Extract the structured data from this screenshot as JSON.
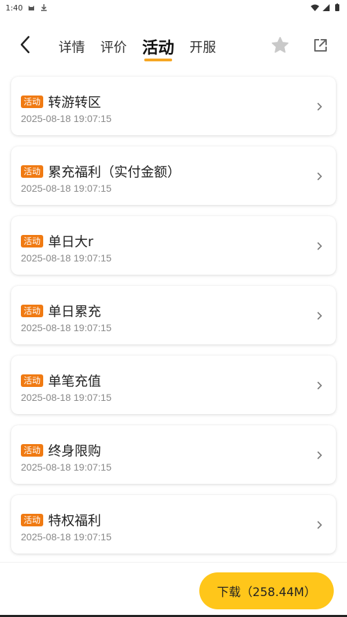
{
  "status_bar": {
    "time": "1:40"
  },
  "header": {
    "tabs": [
      {
        "label": "详情",
        "active": false
      },
      {
        "label": "评价",
        "active": false
      },
      {
        "label": "活动",
        "active": true
      },
      {
        "label": "开服",
        "active": false
      }
    ]
  },
  "activities": [
    {
      "badge": "活动",
      "title": "转游转区",
      "date": "2025-08-18 19:07:15"
    },
    {
      "badge": "活动",
      "title": "累充福利（实付金额）",
      "date": "2025-08-18 19:07:15"
    },
    {
      "badge": "活动",
      "title": "单日大r",
      "date": "2025-08-18 19:07:15"
    },
    {
      "badge": "活动",
      "title": "单日累充",
      "date": "2025-08-18 19:07:15"
    },
    {
      "badge": "活动",
      "title": "单笔充值",
      "date": "2025-08-18 19:07:15"
    },
    {
      "badge": "活动",
      "title": "终身限购",
      "date": "2025-08-18 19:07:15"
    },
    {
      "badge": "活动",
      "title": "特权福利",
      "date": "2025-08-18 19:07:15"
    }
  ],
  "bottom": {
    "download_label": "下载（258.44M）"
  },
  "colors": {
    "accent": "#f5a623",
    "badge": "#f07a12",
    "download": "#ffc61a"
  },
  "icons": [
    "back-arrow-icon",
    "star-icon",
    "share-icon",
    "chevron-right-icon"
  ]
}
